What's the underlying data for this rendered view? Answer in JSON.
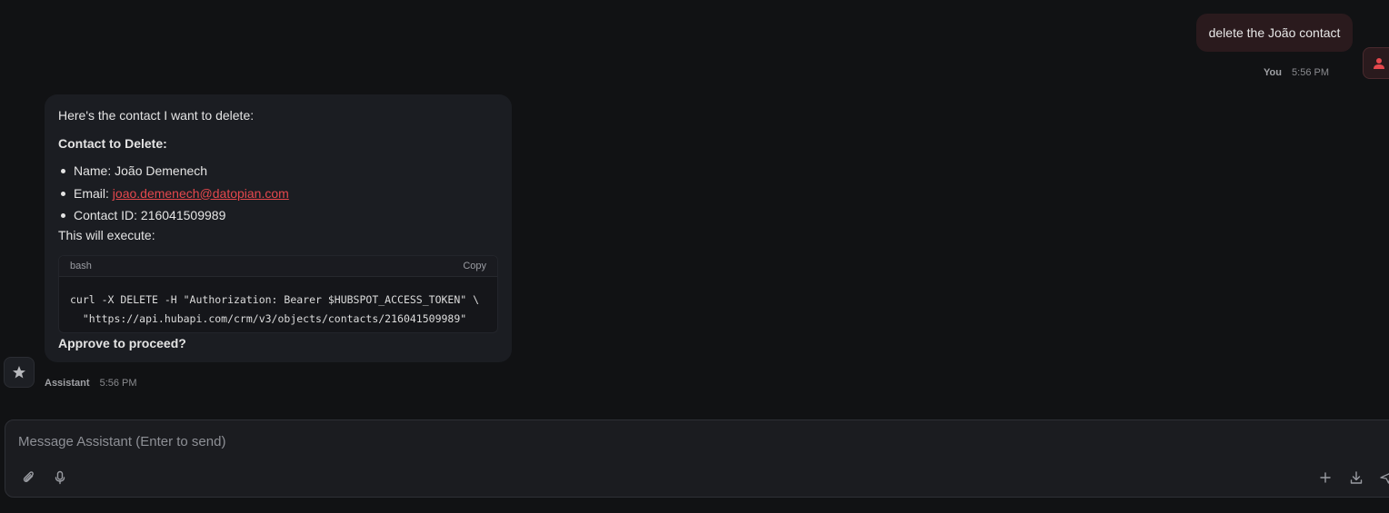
{
  "user_message": {
    "text": "delete the João contact",
    "author": "You",
    "time": "5:56 PM",
    "avatar_icon": "user-icon",
    "accent_color": "#e5484d"
  },
  "assistant_message": {
    "intro": "Here's the contact I want to delete:",
    "heading": "Contact to Delete:",
    "name_label": "Name: João Demenech",
    "email_prefix": "Email: ",
    "email": "joao.demenech@datopian.com",
    "contact_id_label": "Contact ID: 216041509989",
    "execute_label": "This will execute:",
    "code": {
      "language": "bash",
      "copy_label": "Copy",
      "line1": "curl -X DELETE -H \"Authorization: Bearer $HUBSPOT_ACCESS_TOKEN\" \\",
      "line2": "  \"https://api.hubapi.com/crm/v3/objects/contacts/216041509989\""
    },
    "approve_label": "Approve to proceed?",
    "author": "Assistant",
    "time": "5:56 PM",
    "avatar_icon": "star-icon"
  },
  "composer": {
    "placeholder": "Message Assistant (Enter to send)",
    "value": "",
    "left_tools": [
      "paperclip-icon",
      "microphone-icon"
    ],
    "right_tools": [
      "plus-icon",
      "download-icon",
      "send-icon"
    ]
  }
}
